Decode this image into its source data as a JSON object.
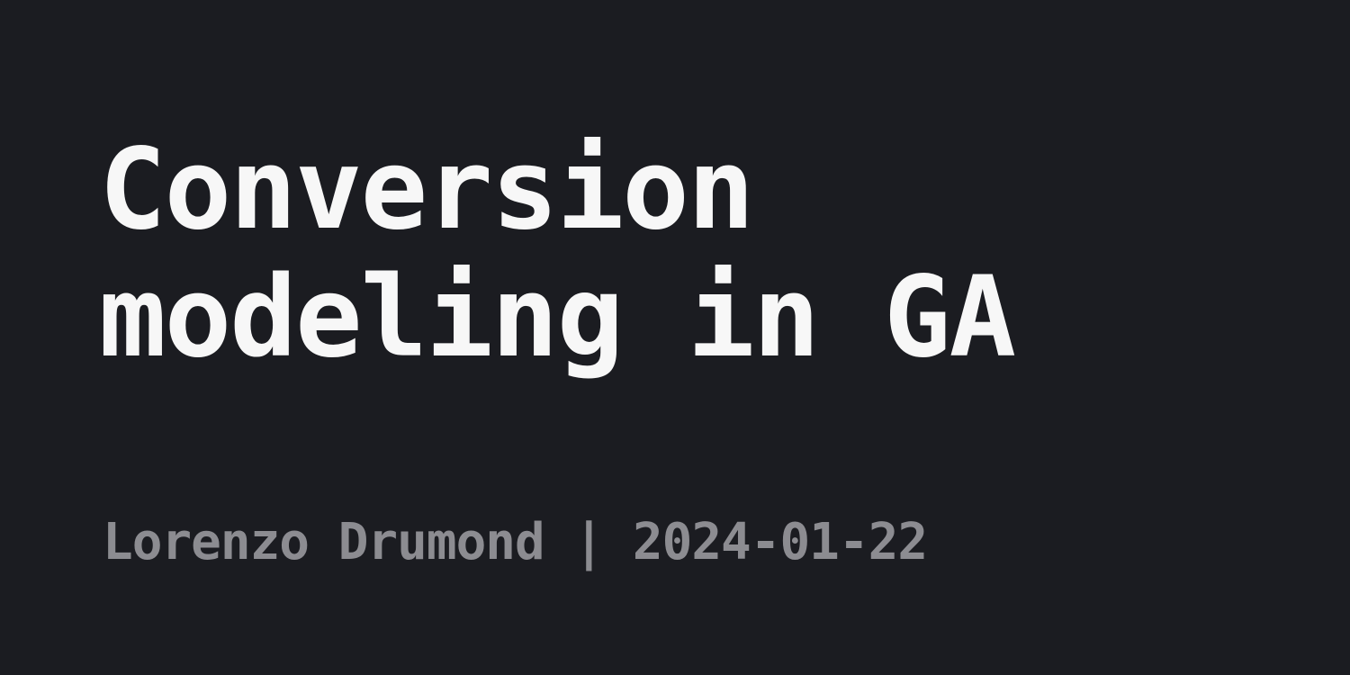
{
  "title": {
    "line1": "Conversion",
    "line2": "modeling in GA"
  },
  "meta": {
    "author": "Lorenzo Drumond",
    "separator": "|",
    "date": "2024-01-22"
  },
  "colors": {
    "background": "#1b1c21",
    "title": "#f7f7f7",
    "meta": "#8c8c91"
  }
}
